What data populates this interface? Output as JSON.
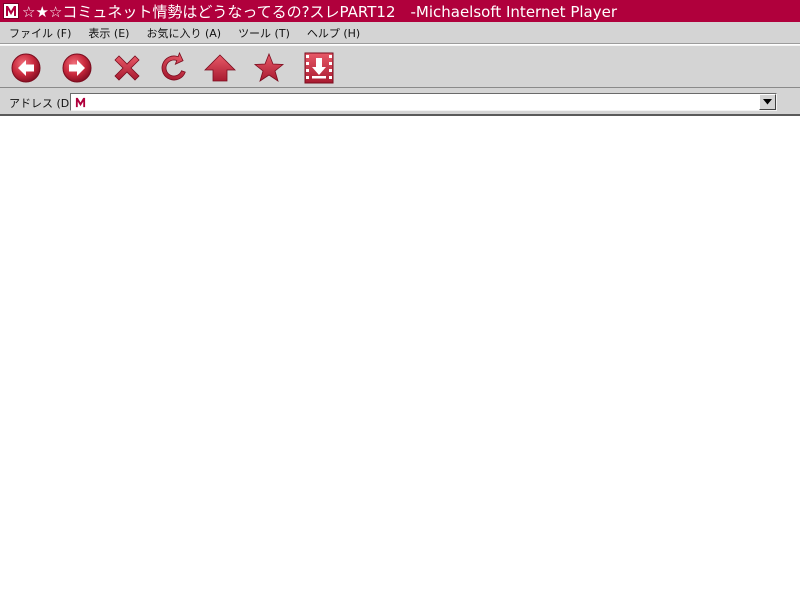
{
  "window": {
    "title": "☆★☆コミュネット情勢はどうなってるの?スレPART12　-Michaelsoft Internet Player",
    "icon": "m-logo-icon"
  },
  "menu": {
    "items": [
      {
        "label": "ファイル (F)"
      },
      {
        "label": "表示 (E)"
      },
      {
        "label": "お気に入り (A)"
      },
      {
        "label": "ツール (T)"
      },
      {
        "label": "ヘルプ (H)"
      }
    ]
  },
  "toolbar": {
    "buttons": [
      {
        "name": "back",
        "icon": "back-arrow-icon"
      },
      {
        "name": "forward",
        "icon": "forward-arrow-icon"
      },
      {
        "name": "stop",
        "icon": "stop-x-icon"
      },
      {
        "name": "refresh",
        "icon": "refresh-icon"
      },
      {
        "name": "home",
        "icon": "home-arrow-icon"
      },
      {
        "name": "favorites",
        "icon": "star-icon"
      },
      {
        "name": "download",
        "icon": "download-icon"
      }
    ]
  },
  "address": {
    "label": "アドレス (D)",
    "value": ""
  },
  "colors": {
    "accent": "#b0003c",
    "chrome": "#d4d4d4",
    "icon": "#c8283c"
  }
}
